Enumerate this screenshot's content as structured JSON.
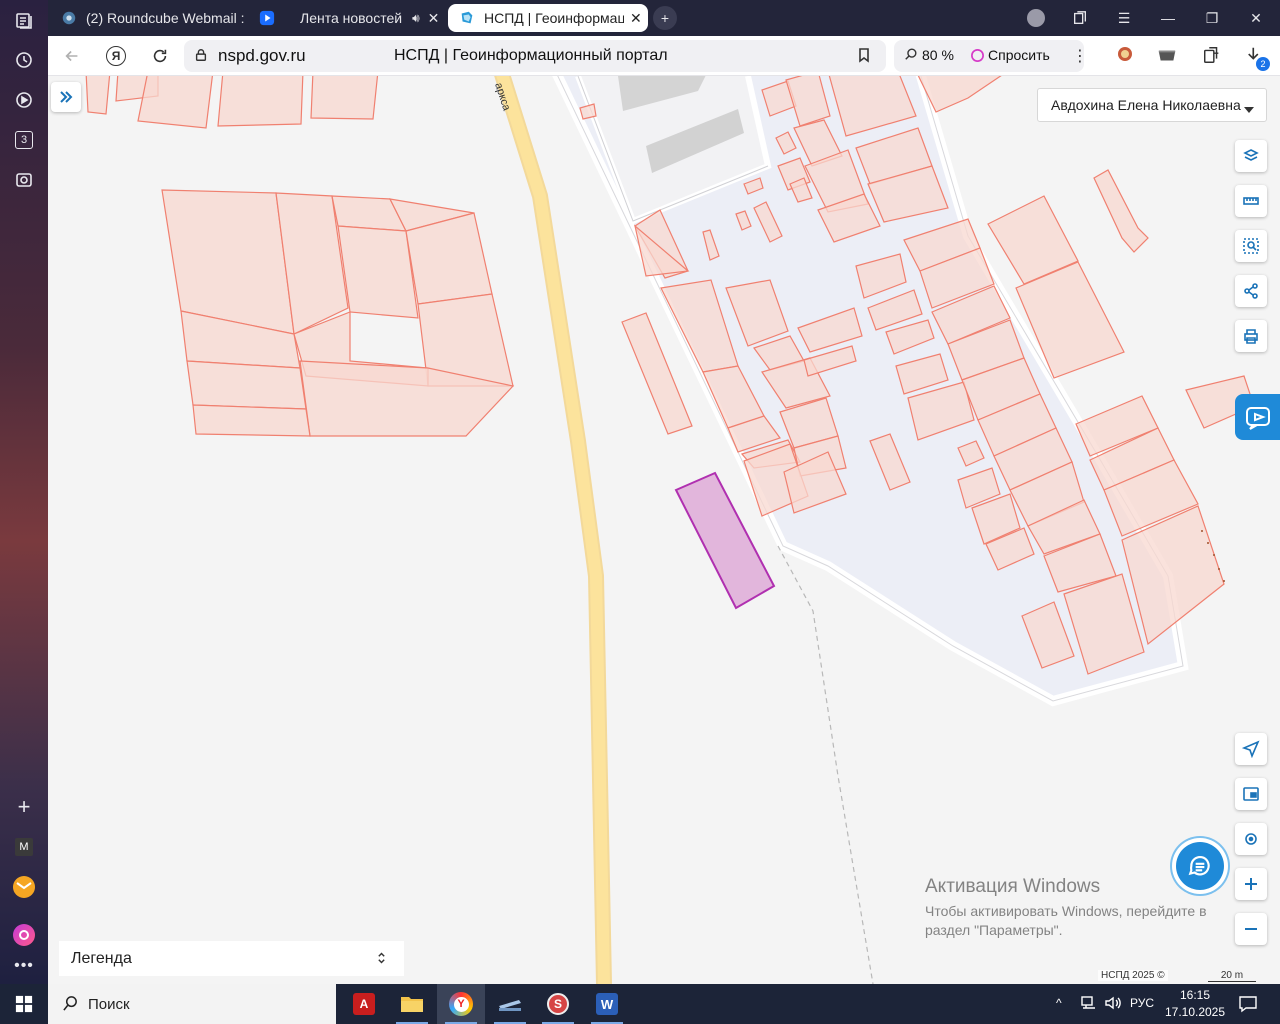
{
  "browser": {
    "tabs": [
      {
        "title": "(2) Roundcube Webmail ::",
        "active": false
      },
      {
        "title": "Лента новостей",
        "active": false
      },
      {
        "title": "НСПД | Геоинформационный портал",
        "active": true
      }
    ],
    "address": {
      "url": "nspd.gov.ru",
      "page_title": "НСПД | Геоинформационный портал",
      "zoom": "80 %",
      "ask_label": "Спросить"
    },
    "downloads_badge": "2",
    "side_badge": "3",
    "side_m": "M"
  },
  "map": {
    "user_menu": "Авдохина Елена Николаевна",
    "legend_label": "Легенда",
    "street_label": "арксa",
    "attribution": "НСПД 2025 ©",
    "scale_label": "20 m",
    "accent_color": "#1a73b8",
    "parcel_color": "#f08070",
    "selected_parcel_color": "#b030b0"
  },
  "windows_activation": {
    "title": "Активация Windows",
    "text": "Чтобы активировать Windows, перейдите в раздел \"Параметры\"."
  },
  "taskbar": {
    "search_placeholder": "Поиск",
    "language": "РУС",
    "time": "16:15",
    "date": "17.10.2025"
  }
}
